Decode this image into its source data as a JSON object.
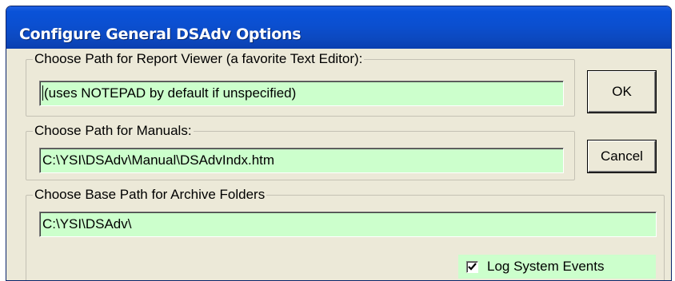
{
  "window": {
    "title": "Configure General DSAdv Options"
  },
  "groups": {
    "report_viewer": {
      "label": "Choose Path for Report Viewer (a favorite Text Editor):",
      "value": "(uses NOTEPAD by default if unspecified)"
    },
    "manuals": {
      "label": "Choose Path for Manuals:",
      "value": "C:\\YSI\\DSAdv\\Manual\\DSAdvIndx.htm"
    },
    "archive": {
      "label": "Choose Base Path for Archive Folders",
      "value": "C:\\YSI\\DSAdv\\"
    }
  },
  "buttons": {
    "ok": "OK",
    "cancel": "Cancel"
  },
  "log_events": {
    "label": "Log System Events",
    "checked": true
  },
  "colors": {
    "field_bg": "#ccffcc",
    "dialog_bg": "#ece9d8",
    "titlebar": "#0a52d8"
  },
  "icons": {
    "checkbox_mark": "checkmark-icon"
  }
}
